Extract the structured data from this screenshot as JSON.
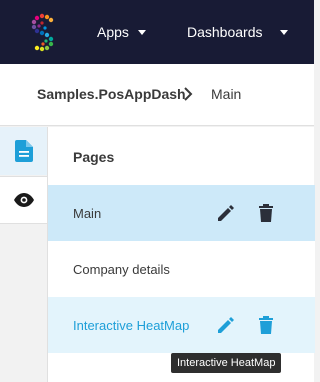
{
  "header": {
    "apps_label": "Apps",
    "dashboards_label": "Dashboards",
    "background": "#181b35"
  },
  "breadcrumb": {
    "root": "Samples.PosAppDash",
    "current": "Main"
  },
  "side_rail": {
    "tabs": [
      {
        "icon": "document-icon",
        "active": true
      },
      {
        "icon": "eye-icon",
        "active": false
      }
    ]
  },
  "pages": {
    "title": "Pages",
    "items": [
      {
        "label": "Main",
        "state": "selected",
        "actions": [
          "pencil-icon",
          "trash-icon"
        ]
      },
      {
        "label": "Company details",
        "state": "normal"
      },
      {
        "label": "Interactive HeatMap",
        "state": "hover",
        "actions": [
          "pencil-icon",
          "trash-icon"
        ]
      }
    ]
  },
  "tooltip": {
    "text": "Interactive HeatMap"
  },
  "colors": {
    "accent": "#1e9fd8",
    "selected_row": "#cde9f9",
    "hover_row": "#e3f4fc",
    "icon_dark": "#2b2f3a"
  }
}
